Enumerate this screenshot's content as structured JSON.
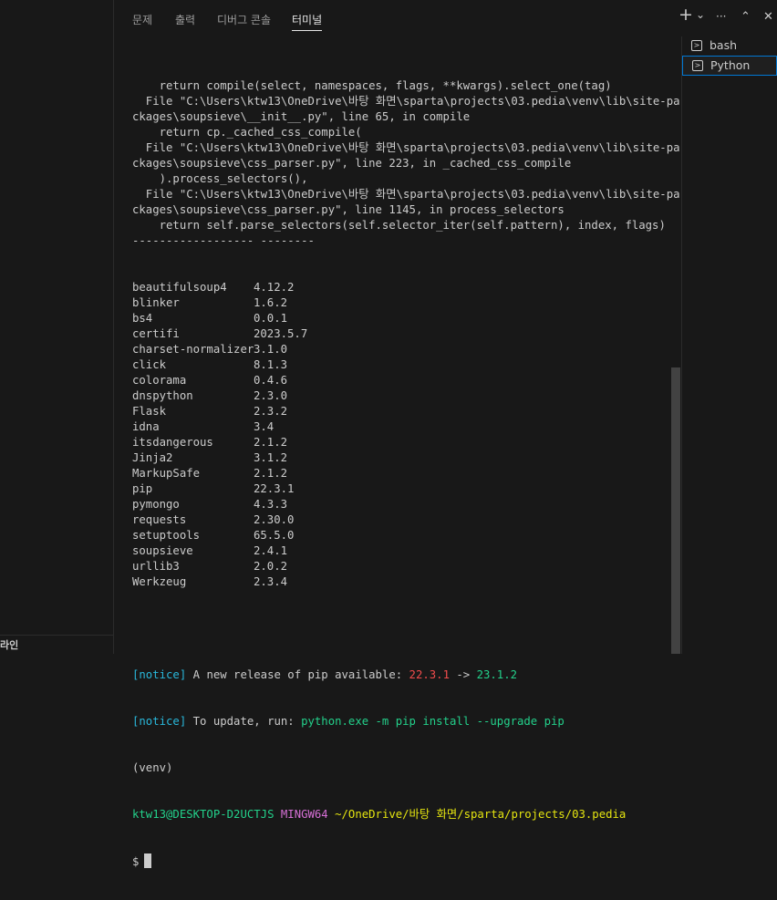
{
  "left_panel": {
    "bottom_label": "라인"
  },
  "tabs": [
    {
      "label": "문제"
    },
    {
      "label": "출력"
    },
    {
      "label": "디버그 콘솔"
    },
    {
      "label": "터미널"
    }
  ],
  "actions": {
    "add": "+",
    "dropdown": "⌄",
    "more": "···",
    "maximize": "⌃",
    "close": "✕"
  },
  "terminal": {
    "traceback": [
      "    return compile(select, namespaces, flags, **kwargs).select_one(tag)",
      "  File \"C:\\Users\\ktw13\\OneDrive\\바탕 화면\\sparta\\projects\\03.pedia\\venv\\lib\\site-pa",
      "ckages\\soupsieve\\__init__.py\", line 65, in compile",
      "    return cp._cached_css_compile(",
      "  File \"C:\\Users\\ktw13\\OneDrive\\바탕 화면\\sparta\\projects\\03.pedia\\venv\\lib\\site-pa",
      "ckages\\soupsieve\\css_parser.py\", line 223, in _cached_css_compile",
      "    ).process_selectors(),",
      "  File \"C:\\Users\\ktw13\\OneDrive\\바탕 화면\\sparta\\projects\\03.pedia\\venv\\lib\\site-pa",
      "ckages\\soupsieve\\css_parser.py\", line 1145, in process_selectors",
      "    return self.parse_selectors(self.selector_iter(self.pattern), index, flags)",
      "------------------ --------"
    ],
    "packages": [
      {
        "name": "beautifulsoup4",
        "version": "4.12.2"
      },
      {
        "name": "blinker",
        "version": "1.6.2"
      },
      {
        "name": "bs4",
        "version": "0.0.1"
      },
      {
        "name": "certifi",
        "version": "2023.5.7"
      },
      {
        "name": "charset-normalizer",
        "version": "3.1.0"
      },
      {
        "name": "click",
        "version": "8.1.3"
      },
      {
        "name": "colorama",
        "version": "0.4.6"
      },
      {
        "name": "dnspython",
        "version": "2.3.0"
      },
      {
        "name": "Flask",
        "version": "2.3.2"
      },
      {
        "name": "idna",
        "version": "3.4"
      },
      {
        "name": "itsdangerous",
        "version": "2.1.2"
      },
      {
        "name": "Jinja2",
        "version": "3.1.2"
      },
      {
        "name": "MarkupSafe",
        "version": "2.1.2"
      },
      {
        "name": "pip",
        "version": "22.3.1"
      },
      {
        "name": "pymongo",
        "version": "4.3.3"
      },
      {
        "name": "requests",
        "version": "2.30.0"
      },
      {
        "name": "setuptools",
        "version": "65.5.0"
      },
      {
        "name": "soupsieve",
        "version": "2.4.1"
      },
      {
        "name": "urllib3",
        "version": "2.0.2"
      },
      {
        "name": "Werkzeug",
        "version": "2.3.4"
      }
    ],
    "notice1": {
      "open": "[",
      "tag": "notice",
      "close": "]",
      "text": " A new release of pip available: ",
      "old": "22.3.1",
      "arrow": " -> ",
      "new": "23.1.2"
    },
    "notice2": {
      "open": "[",
      "tag": "notice",
      "close": "]",
      "text": " To update, run: ",
      "cmd": "python.exe -m pip install --upgrade pip"
    },
    "venv": "(venv)",
    "prompt": {
      "user": "ktw13@DESKTOP-D2UCTJS",
      "shell": "MINGW64",
      "path": "~/OneDrive/바탕 화면/sparta/projects/03.pedia"
    },
    "input_prompt": "$"
  },
  "terminal_list": [
    {
      "label": "bash",
      "icon": "terminal-icon"
    },
    {
      "label": "Python",
      "icon": "terminal-icon",
      "selected": true
    }
  ],
  "colors": {
    "background": "#181818",
    "text": "#cccccc",
    "cyan": "#29b8db",
    "red": "#f14c4c",
    "green": "#23d18b",
    "magenta": "#d670d6",
    "yellow": "#e5e510",
    "accent": "#0078d4"
  }
}
